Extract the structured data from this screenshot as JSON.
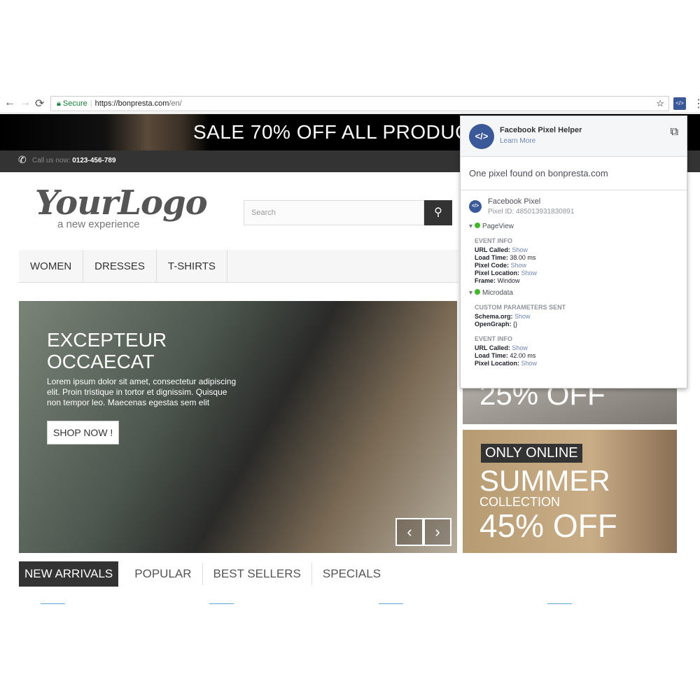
{
  "browser": {
    "secure_label": "Secure",
    "url_host": "https://bonpresta.com",
    "url_path": "/en/",
    "back": "←",
    "forward": "→",
    "reload": "⟳",
    "star": "☆",
    "menu": "⋮",
    "ext_badge": "</>"
  },
  "banner": {
    "text": "SALE 70% OFF ALL PRODUCTS"
  },
  "callbar": {
    "label": "Call us now:",
    "phone": "0123-456-789"
  },
  "logo": {
    "main": "YourLogo",
    "sub": "a new experience"
  },
  "search": {
    "placeholder": "Search"
  },
  "menu": [
    "WOMEN",
    "DRESSES",
    "T-SHIRTS"
  ],
  "hero": {
    "title": "EXCEPTEUR OCCAECAT",
    "text": "Lorem ipsum dolor sit amet, consectetur adipiscing elit. Proin tristique in tortor et dignissim. Quisque non tempor leo. Maecenas egestas sem elit",
    "button": "SHOP NOW !"
  },
  "banner_top": {
    "text": "25% OFF"
  },
  "banner_bottom": {
    "badge": "ONLY ONLINE",
    "title": "SUMMER",
    "subtitle": "COLLECTION",
    "discount": "45% OFF"
  },
  "tabs": [
    "NEW ARRIVALS",
    "POPULAR",
    "BEST SELLERS",
    "SPECIALS"
  ],
  "popup": {
    "title": "Facebook Pixel Helper",
    "learn_more": "Learn More",
    "found": "One pixel found on bonpresta.com",
    "pixel_name": "Facebook Pixel",
    "pixel_id": "Pixel ID: 485013931830891",
    "event1": {
      "name": "PageView",
      "section": "EVENT INFO",
      "rows": [
        [
          "URL Called:",
          "Show"
        ],
        [
          "Load Time:",
          "38.00 ms"
        ],
        [
          "Pixel Code:",
          "Show"
        ],
        [
          "Pixel Location:",
          "Show"
        ],
        [
          "Frame:",
          "Window"
        ]
      ]
    },
    "event2": {
      "name": "Microdata",
      "section": "CUSTOM PARAMETERS SENT",
      "rows": [
        [
          "Schema.org:",
          "Show"
        ],
        [
          "OpenGraph:",
          "{}"
        ]
      ],
      "section2": "EVENT INFO",
      "rows2": [
        [
          "URL Called:",
          "Show"
        ],
        [
          "Load Time:",
          "42.00 ms"
        ],
        [
          "Pixel Location:",
          "Show"
        ]
      ]
    }
  },
  "colors": {
    "facebook": "#3b5998",
    "ok": "#42b72a",
    "dark": "#333333"
  }
}
